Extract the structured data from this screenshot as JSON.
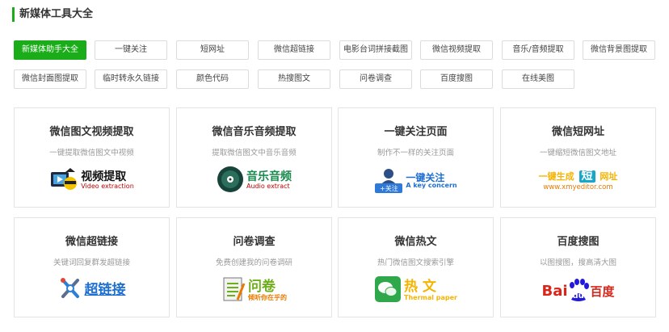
{
  "section": {
    "title": "新媒体工具大全"
  },
  "tags": [
    "新媒体助手大全",
    "一键关注",
    "短网址",
    "微信超链接",
    "电影台词拼接截图",
    "微信视频提取",
    "音乐/音频提取",
    "微信背景图提取",
    "微信封面图提取",
    "临时转永久链接",
    "颜色代码",
    "热搜图文",
    "问卷调查",
    "百度搜图",
    "在线美图"
  ],
  "active_tag": "新媒体助手大全",
  "cards": [
    {
      "title": "微信图文视频提取",
      "desc": "一键提取微信图文中视频",
      "logo_main": "视频提取",
      "logo_sub": "Video extraction",
      "icon": "video-extraction-icon"
    },
    {
      "title": "微信音乐音频提取",
      "desc": "提取微信图文中音乐音频",
      "logo_main": "音乐音频",
      "logo_sub": "Audio extract",
      "icon": "audio-extract-icon"
    },
    {
      "title": "一键关注页面",
      "desc": "制作不一样的关注页面",
      "logo_main": "一键关注",
      "logo_sub": "A key concern",
      "icon_label": "+关注",
      "icon": "follow-icon"
    },
    {
      "title": "微信短网址",
      "desc": "一键缩短微信图文地址",
      "logo_main": "一键生成",
      "logo_mid": "短",
      "logo_end": "网址",
      "logo_sub": "www.xmyeditor.com",
      "icon": "short-url-icon"
    },
    {
      "title": "微信超链接",
      "desc": "关键词回复群发超链接",
      "logo_main": "超链接",
      "icon": "link-icon"
    },
    {
      "title": "问卷调查",
      "desc": "免费创建我的问卷调研",
      "logo_main": "问卷",
      "logo_sub": "倾听你在乎的",
      "icon": "survey-icon"
    },
    {
      "title": "微信热文",
      "desc": "热门微信图文搜索引擎",
      "logo_main": "热 文",
      "logo_sub": "Thermal paper",
      "icon": "wechat-icon"
    },
    {
      "title": "百度搜图",
      "desc": "以图搜图，搜高清大图",
      "logo_main_a": "Bai",
      "logo_main_b": "du",
      "logo_cn": "百度",
      "icon": "baidu-paw-icon"
    }
  ],
  "colors": {
    "accent": "#1aad19",
    "border": "#e4e4e4",
    "desc": "#999999"
  }
}
